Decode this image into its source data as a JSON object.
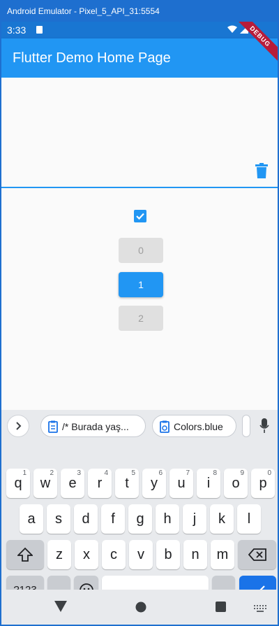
{
  "window": {
    "title": "Android Emulator - Pixel_5_API_31:5554"
  },
  "status": {
    "time": "3:33"
  },
  "app_bar": {
    "title": "Flutter Demo Home Page",
    "ribbon": "DEBUG"
  },
  "content": {
    "checkbox_checked": true,
    "buttons": [
      {
        "label": "0",
        "selected": false
      },
      {
        "label": "1",
        "selected": true
      },
      {
        "label": "2",
        "selected": false
      }
    ]
  },
  "keyboard": {
    "suggestions": [
      "/* Burada yaş...",
      "Colors.blue"
    ],
    "row1": [
      {
        "k": "q",
        "h": "1"
      },
      {
        "k": "w",
        "h": "2"
      },
      {
        "k": "e",
        "h": "3"
      },
      {
        "k": "r",
        "h": "4"
      },
      {
        "k": "t",
        "h": "5"
      },
      {
        "k": "y",
        "h": "6"
      },
      {
        "k": "u",
        "h": "7"
      },
      {
        "k": "i",
        "h": "8"
      },
      {
        "k": "o",
        "h": "9"
      },
      {
        "k": "p",
        "h": "0"
      }
    ],
    "row2": [
      "a",
      "s",
      "d",
      "f",
      "g",
      "h",
      "j",
      "k",
      "l"
    ],
    "row3": [
      "z",
      "x",
      "c",
      "v",
      "b",
      "n",
      "m"
    ],
    "symbols_label": "?123",
    "comma_label": ",",
    "period_label": "."
  },
  "colors": {
    "primary": "#2196f3",
    "status_bar": "#1976d2",
    "enter_key": "#1a73e8"
  }
}
